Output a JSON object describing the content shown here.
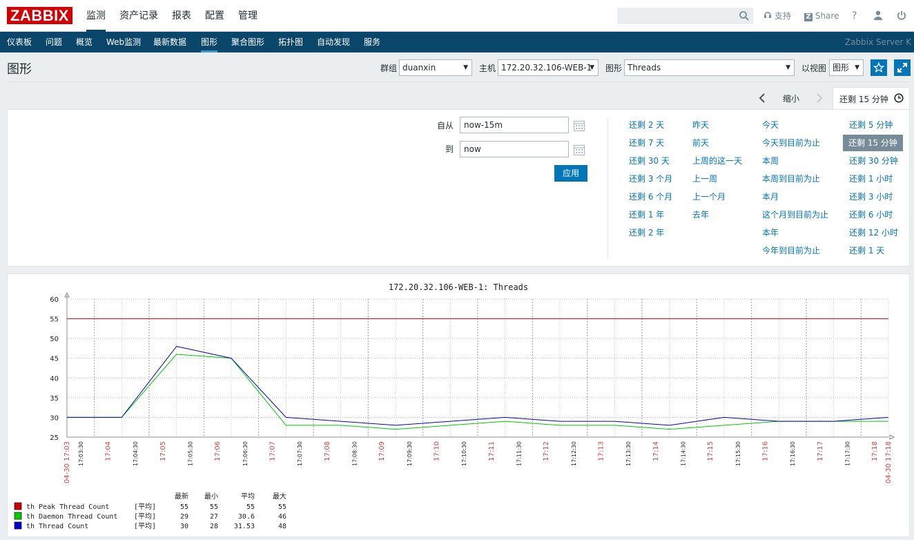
{
  "brand": "ZABBIX",
  "top_menu": [
    "监测",
    "资产记录",
    "报表",
    "配置",
    "管理"
  ],
  "top_links": {
    "support": "支持",
    "share": "Share",
    "help": "?"
  },
  "sub_menu": [
    "仪表板",
    "问题",
    "概览",
    "Web监测",
    "最新数据",
    "图形",
    "聚合图形",
    "拓扑图",
    "自动发现",
    "服务"
  ],
  "server_name": "Zabbix Server K",
  "page_title": "图形",
  "filters": {
    "group_label": "群组",
    "group_value": "duanxin",
    "host_label": "主机",
    "host_value": "172.20.32.106-WEB-1",
    "graph_label": "图形",
    "graph_value": "Threads",
    "view_label": "以视图",
    "view_value": "图形"
  },
  "timebar": {
    "zoom_out": "缩小",
    "current": "还剩 15 分钟"
  },
  "time_filter": {
    "from_label": "自从",
    "from_value": "now-15m",
    "to_label": "到",
    "to_value": "now",
    "apply": "应用"
  },
  "quick_ranges": [
    [
      "还剩 2 天",
      "还剩 7 天",
      "还剩 30 天",
      "还剩 3 个月",
      "还剩 6 个月",
      "还剩 1 年",
      "还剩 2 年"
    ],
    [
      "昨天",
      "前天",
      "上周的这一天",
      "上一周",
      "上一个月",
      "去年"
    ],
    [
      "今天",
      "今天到目前为止",
      "本周",
      "本周到目前为止",
      "本月",
      "这个月到目前为止",
      "本年",
      "今年到目前为止"
    ],
    [
      "还剩 5 分钟",
      "还剩 15 分钟",
      "还剩 30 分钟",
      "还剩 1 小时",
      "还剩 3 小时",
      "还剩 6 小时",
      "还剩 12 小时",
      "还剩 1 天"
    ]
  ],
  "colors": {
    "accent": "#0275b8",
    "nav": "#0a466a",
    "brand": "#d40000"
  },
  "chart_data": {
    "type": "line",
    "title": "172.20.32.106-WEB-1: Threads",
    "ylim": [
      25,
      60
    ],
    "y_ticks": [
      "25",
      "30",
      "35",
      "40",
      "45",
      "50",
      "55",
      "60"
    ],
    "x_ticks": [
      "17:03:30",
      "17:04:00",
      "17:04:30",
      "17:05:00",
      "17:05:30",
      "17:06:00",
      "17:06:30",
      "17:07:00",
      "17:07:30",
      "17:08:00",
      "17:08:30",
      "17:09:00",
      "17:09:30",
      "17:10:00",
      "17:10:30",
      "17:11:00",
      "17:11:30",
      "17:12:00",
      "17:12:30",
      "17:13:00",
      "17:13:30",
      "17:14:00",
      "17:14:30",
      "17:15:00",
      "17:15:30",
      "17:16:00",
      "17:16:30",
      "17:17:00",
      "17:17:30",
      "17:18:00"
    ],
    "x_start_label": "04-30 17:03",
    "x_end_label": "04-30 17:18",
    "x": [
      "17:03",
      "17:04",
      "17:05",
      "17:06",
      "17:07",
      "17:08",
      "17:09",
      "17:10",
      "17:11",
      "17:12",
      "17:13",
      "17:14",
      "17:15",
      "17:16",
      "17:17",
      "17:18"
    ],
    "series": [
      {
        "name": "th Peak Thread Count",
        "color": "#cc0000",
        "values": [
          55,
          55,
          55,
          55,
          55,
          55,
          55,
          55,
          55,
          55,
          55,
          55,
          55,
          55,
          55,
          55
        ]
      },
      {
        "name": "th Daemon Thread Count",
        "color": "#00cc00",
        "values": [
          30,
          30,
          46,
          45,
          28,
          28,
          27,
          28,
          29,
          28,
          28,
          27,
          28,
          29,
          29,
          29
        ]
      },
      {
        "name": "th Thread Count",
        "color": "#0000cc",
        "values": [
          30,
          30,
          48,
          45,
          30,
          29,
          28,
          29,
          30,
          29,
          29,
          28,
          30,
          29,
          29,
          30
        ]
      }
    ],
    "legend": {
      "headers": [
        "最新",
        "最小",
        "平均",
        "最大"
      ],
      "func": "[平均]",
      "rows": [
        [
          "55",
          "55",
          "55",
          "55"
        ],
        [
          "29",
          "27",
          "30.6",
          "46"
        ],
        [
          "30",
          "28",
          "31.53",
          "48"
        ]
      ]
    }
  }
}
